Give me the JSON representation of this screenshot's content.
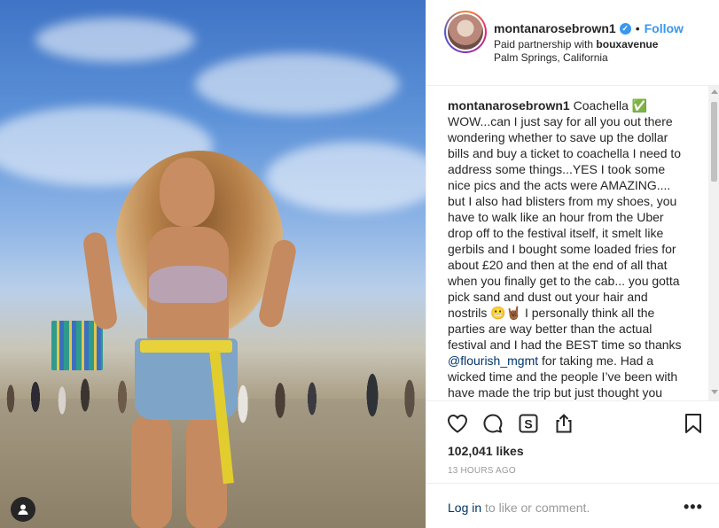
{
  "post_header": {
    "username": "montanarosebrown1",
    "verified_badge": "✓",
    "separator": "•",
    "follow_label": "Follow",
    "partnership_prefix": "Paid partnership with",
    "partner": "bouxavenue",
    "location": "Palm Springs, California"
  },
  "caption": {
    "username": "montanarosebrown1",
    "text_part1": "Coachella ✅\nWOW...can I just say for all you out there wondering whether to save up the dollar bills and buy a ticket to coachella I need to address some things...YES I took some nice pics and the acts were AMAZING.... but I also had blisters from my shoes, you have to walk like an hour from the Uber drop off to the festival itself, it smelt like gerbils and I bought some loaded fries for about £20 and then at the end of all that when you finally get to the cab... you gotta pick sand and dust out your hair and nostrils 😬🤘🏾 I personally think all the parties are way better than the actual festival and I had the BEST time so thanks ",
    "mention": "@flourish_mgmt",
    "text_part2": " for taking me. Had a wicked time and the people I’ve been with have made the trip but just thought you should all know that"
  },
  "actions": {
    "likes": "102,041 likes",
    "timestamp": "13 HOURS AGO",
    "login_link": "Log in",
    "login_suffix": " to like or comment.",
    "more": "•••"
  },
  "icons": {
    "like": "heart-icon",
    "comment": "comment-icon",
    "shop": "shopping-bag-icon",
    "share": "share-icon",
    "save": "bookmark-icon",
    "user_tag": "user-tag-icon"
  },
  "colors": {
    "link_blue": "#3897f0",
    "mention_blue": "#003569",
    "text": "#262626",
    "muted": "#999999"
  }
}
